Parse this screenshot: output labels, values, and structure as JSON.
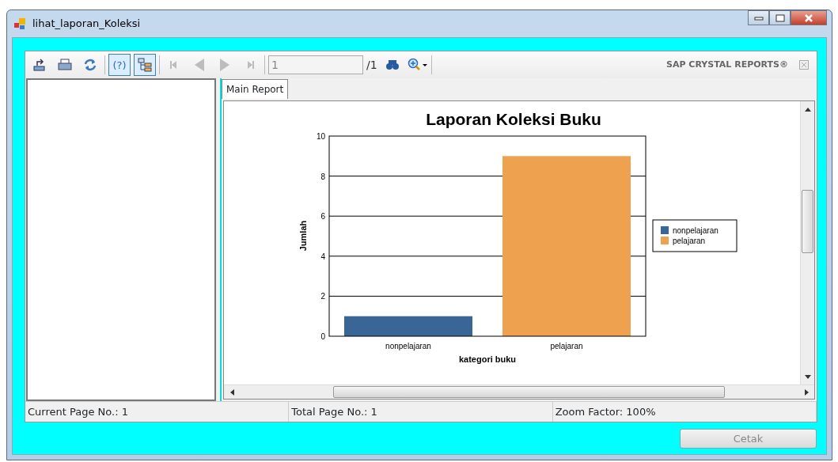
{
  "window": {
    "title": "lihat_laporan_Koleksi"
  },
  "toolbar": {
    "buttons": [
      {
        "kind": "export",
        "pressed": false,
        "disabled": false
      },
      {
        "kind": "print",
        "pressed": false,
        "disabled": false
      },
      {
        "kind": "refresh",
        "pressed": false,
        "disabled": false
      },
      {
        "kind": "sep"
      },
      {
        "kind": "help",
        "label": "(?)",
        "pressed": true,
        "disabled": false
      },
      {
        "kind": "tree",
        "pressed": true,
        "disabled": false
      },
      {
        "kind": "sep"
      },
      {
        "kind": "first",
        "pressed": false,
        "disabled": true
      },
      {
        "kind": "prev",
        "pressed": false,
        "disabled": true
      },
      {
        "kind": "next",
        "pressed": false,
        "disabled": true
      },
      {
        "kind": "last",
        "pressed": false,
        "disabled": true
      },
      {
        "kind": "sep"
      }
    ],
    "page_field": "1",
    "page_total": "/1",
    "brand": "SAP CRYSTAL REPORTS®"
  },
  "tabs": [
    {
      "label": "Main Report",
      "selected": true
    }
  ],
  "report": {
    "chart_data": {
      "type": "bar",
      "title": "Laporan Koleksi Buku",
      "xlabel": "kategori buku",
      "ylabel": "Jumlah",
      "categories": [
        "nonpelajaran",
        "pelajaran"
      ],
      "ylim": [
        0,
        10
      ],
      "grid": true,
      "legend": true,
      "yticks": [
        0,
        2,
        4,
        6,
        8,
        10
      ],
      "series": [
        {
          "name": "nonpelajaran",
          "color": "#3a6597",
          "values": [
            1,
            null
          ]
        },
        {
          "name": "pelajaran",
          "color": "#eea250",
          "values": [
            null,
            9
          ]
        }
      ]
    }
  },
  "status_bar": [
    "Current Page No.: 1",
    "Total Page No.: 1",
    "Zoom Factor: 100%"
  ],
  "print_button": {
    "label": "Cetak",
    "disabled": true
  }
}
